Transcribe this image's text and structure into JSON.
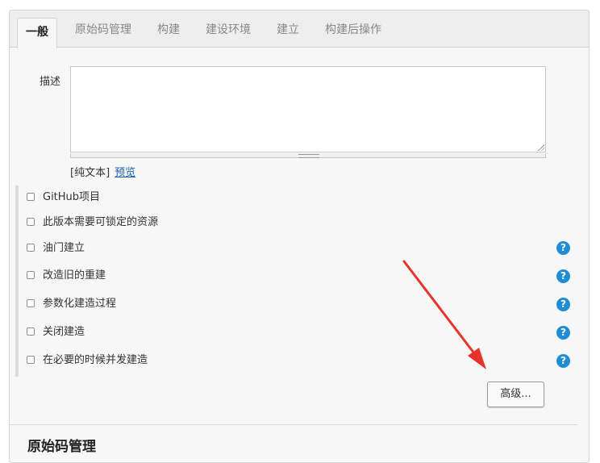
{
  "tabs": [
    {
      "label": "一般",
      "active": true
    },
    {
      "label": "原始码管理"
    },
    {
      "label": "构建"
    },
    {
      "label": "建设环境"
    },
    {
      "label": "建立"
    },
    {
      "label": "构建后操作"
    }
  ],
  "description": {
    "label": "描述",
    "value": "",
    "format_label": "[纯文本]",
    "preview_link": "预览"
  },
  "options": [
    {
      "label": "GitHub项目",
      "checked": false,
      "has_help": false
    },
    {
      "label": "此版本需要可锁定的资源",
      "checked": false,
      "has_help": false
    },
    {
      "label": "油门建立",
      "checked": false,
      "has_help": true
    },
    {
      "label": "改造旧的重建",
      "checked": false,
      "has_help": true
    },
    {
      "label": "参数化建造过程",
      "checked": false,
      "has_help": true
    },
    {
      "label": "关闭建造",
      "checked": false,
      "has_help": true
    },
    {
      "label": "在必要的时候并发建造",
      "checked": false,
      "has_help": true
    }
  ],
  "help_icon_glyph": "?",
  "advanced_button": "高级...",
  "next_section_title": "原始码管理",
  "colors": {
    "help_icon": "#1f8dd6",
    "annotation_arrow": "#e8322c"
  }
}
